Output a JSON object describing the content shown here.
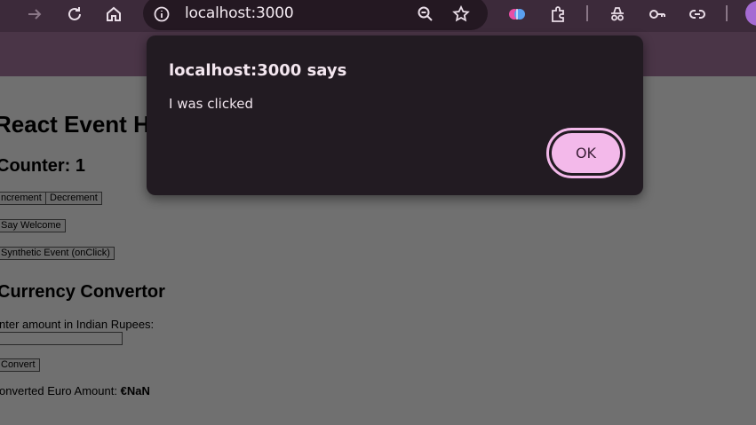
{
  "browser": {
    "url": "localhost:3000",
    "icons": [
      "back-icon",
      "forward-icon",
      "reload-icon",
      "home-icon",
      "site-info-icon",
      "zoom-icon",
      "bookmark-star-icon",
      "extension-brain-icon",
      "extensions-puzzle-icon",
      "incognito-icon",
      "password-key-icon",
      "link-icon"
    ],
    "profile_initial": ""
  },
  "page": {
    "heading": "React Event H",
    "counter_heading": "Counter: 1",
    "increment_label": "ncrement",
    "decrement_label": "Decrement",
    "welcome_label": "Say Welcome",
    "synthetic_label": "Synthetic Event (onClick)",
    "currency_heading": "Currency Convertor",
    "amount_label": "nter amount in Indian Rupees:",
    "amount_value": "",
    "convert_label": "Convert",
    "result_prefix": "onverted Euro Amount: ",
    "result_value": "€NaN"
  },
  "dialog": {
    "title": "localhost:3000 says",
    "message": "I was clicked",
    "ok_label": "OK"
  },
  "colors": {
    "toolbar": "#3c2a3a",
    "dialog_bg": "#221b22",
    "ok_button": "#f3b9ea",
    "overlay_page": "#707070"
  }
}
